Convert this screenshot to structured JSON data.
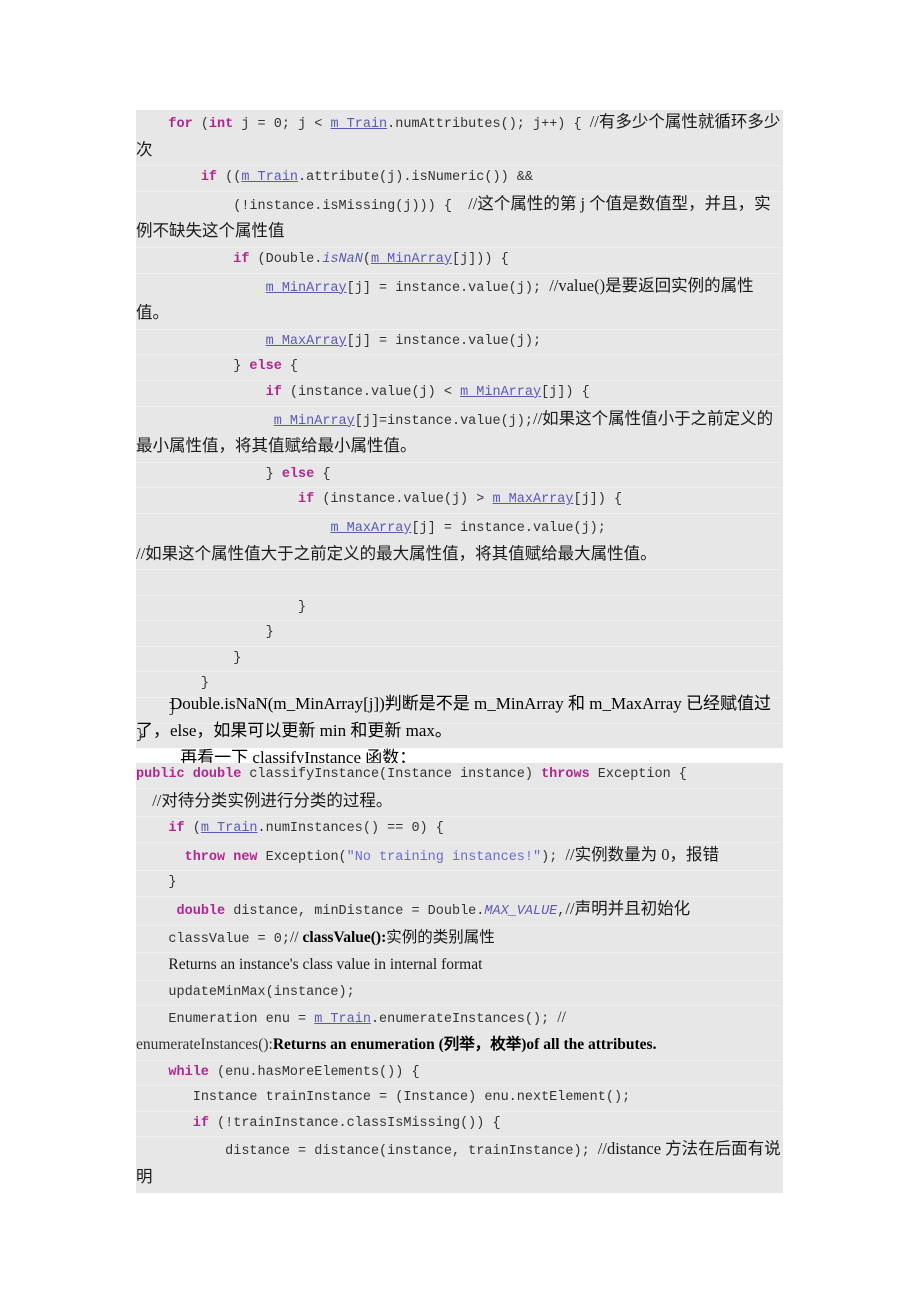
{
  "document": {
    "page_background": "#ffffff",
    "code_background": "#e7e7e7",
    "keyword_color": "#b0268f",
    "identifier_color": "#5a5ab4",
    "string_color": "#6b6bd6"
  },
  "code_block_1": {
    "name": "updateMinMax inner loop",
    "lines": [
      {
        "id": "l1",
        "segments": [
          {
            "t": "    ",
            "s": "plain"
          },
          {
            "t": "for",
            "s": "kw"
          },
          {
            "t": " (",
            "s": "plain"
          },
          {
            "t": "int",
            "s": "kw"
          },
          {
            "t": " j = 0; j < ",
            "s": "plain"
          },
          {
            "t": "m_Train",
            "s": "ident"
          },
          {
            "t": ".numAttributes(); j++) { ",
            "s": "plain"
          },
          {
            "t": "//有多少个属性就循环多少次",
            "s": "cmt-cn"
          }
        ]
      },
      {
        "id": "l2",
        "segments": [
          {
            "t": "        ",
            "s": "plain"
          },
          {
            "t": "if",
            "s": "kw"
          },
          {
            "t": " ((",
            "s": "plain"
          },
          {
            "t": "m_Train",
            "s": "ident"
          },
          {
            "t": ".attribute(j).isNumeric()) &&",
            "s": "plain"
          }
        ]
      },
      {
        "id": "l3",
        "segments": [
          {
            "t": "            (!instance.isMissing(j))) {  ",
            "s": "plain"
          },
          {
            "t": "//这个属性的第 j 个值是数值型，并且，实例不缺失这个属性值",
            "s": "cmt-cn"
          }
        ]
      },
      {
        "id": "l4",
        "segments": [
          {
            "t": "            ",
            "s": "plain"
          },
          {
            "t": "if",
            "s": "kw"
          },
          {
            "t": " (Double.",
            "s": "plain"
          },
          {
            "t": "isNaN",
            "s": "field"
          },
          {
            "t": "(",
            "s": "plain"
          },
          {
            "t": "m_MinArray",
            "s": "ident"
          },
          {
            "t": "[j])) {",
            "s": "plain"
          }
        ]
      },
      {
        "id": "l5",
        "segments": [
          {
            "t": "                ",
            "s": "plain"
          },
          {
            "t": "m_MinArray",
            "s": "ident"
          },
          {
            "t": "[j] = instance.value(j); ",
            "s": "plain"
          },
          {
            "t": "//value()是要返回实例的属性值。",
            "s": "cmt-cn"
          }
        ]
      },
      {
        "id": "l6",
        "segments": [
          {
            "t": "                ",
            "s": "plain"
          },
          {
            "t": "m_MaxArray",
            "s": "ident"
          },
          {
            "t": "[j] = instance.value(j);",
            "s": "plain"
          }
        ]
      },
      {
        "id": "l7",
        "segments": [
          {
            "t": "            } ",
            "s": "plain"
          },
          {
            "t": "else",
            "s": "kw"
          },
          {
            "t": " {",
            "s": "plain"
          }
        ]
      },
      {
        "id": "l8",
        "segments": [
          {
            "t": "                ",
            "s": "plain"
          },
          {
            "t": "if",
            "s": "kw"
          },
          {
            "t": " (instance.value(j) < ",
            "s": "plain"
          },
          {
            "t": "m_MinArray",
            "s": "ident"
          },
          {
            "t": "[j]) {",
            "s": "plain"
          }
        ]
      },
      {
        "id": "l9",
        "segments": [
          {
            "t": "                 ",
            "s": "plain"
          },
          {
            "t": "m_MinArray",
            "s": "ident"
          },
          {
            "t": "[j]=instance.value(j);",
            "s": "plain"
          },
          {
            "t": "//如果这个属性值小于之前定义的最小属性值，将其值赋给最小属性值。",
            "s": "cmt-cn"
          }
        ]
      },
      {
        "id": "l10",
        "segments": [
          {
            "t": "                } ",
            "s": "plain"
          },
          {
            "t": "else",
            "s": "kw"
          },
          {
            "t": " {",
            "s": "plain"
          }
        ]
      },
      {
        "id": "l11",
        "segments": [
          {
            "t": "                    ",
            "s": "plain"
          },
          {
            "t": "if",
            "s": "kw"
          },
          {
            "t": " (instance.value(j) > ",
            "s": "plain"
          },
          {
            "t": "m_MaxArray",
            "s": "ident"
          },
          {
            "t": "[j]) {",
            "s": "plain"
          }
        ]
      },
      {
        "id": "l12",
        "segments": [
          {
            "t": "                        ",
            "s": "plain"
          },
          {
            "t": "m_MaxArray",
            "s": "ident"
          },
          {
            "t": "[j] = instance.value(j);",
            "s": "plain"
          },
          {
            "t": "\n//如果这个属性值大于之前定义的最大属性值，将其值赋给最大属性值。",
            "s": "cmt-cn"
          }
        ]
      },
      {
        "id": "l13",
        "segments": [
          {
            "t": " ",
            "s": "plain"
          }
        ]
      },
      {
        "id": "l14",
        "segments": [
          {
            "t": "                    }",
            "s": "plain"
          }
        ]
      },
      {
        "id": "l15",
        "segments": [
          {
            "t": "                }",
            "s": "plain"
          }
        ]
      },
      {
        "id": "l16",
        "segments": [
          {
            "t": "            }",
            "s": "plain"
          }
        ]
      },
      {
        "id": "l17",
        "segments": [
          {
            "t": "        }",
            "s": "plain"
          }
        ]
      },
      {
        "id": "l18",
        "segments": [
          {
            "t": "    }",
            "s": "plain"
          }
        ]
      },
      {
        "id": "l19",
        "segments": [
          {
            "t": "}",
            "s": "plain"
          }
        ]
      }
    ]
  },
  "prose": {
    "isnan_paragraph": "Double.isNaN(m_MinArray[j])判断是不是 m_MinArray 和 m_MaxArray 已经赋值过了，else，如果可以更新 min 和更新 max。",
    "classify_lead": "再看一下 classifyInstance 函数："
  },
  "code_block_2": {
    "name": "classifyInstance",
    "lines": [
      {
        "id": "m1",
        "segments": [
          {
            "t": "public",
            "s": "kw"
          },
          {
            "t": " ",
            "s": "plain"
          },
          {
            "t": "double",
            "s": "kw"
          },
          {
            "t": " classifyInstance(Instance instance) ",
            "s": "plain"
          },
          {
            "t": "throws",
            "s": "kw"
          },
          {
            "t": " Exception {",
            "s": "plain"
          }
        ]
      },
      {
        "id": "m2",
        "segments": [
          {
            "t": "  ",
            "s": "plain"
          },
          {
            "t": "//对待分类实例进行分类的过程。",
            "s": "cmt-cn"
          }
        ]
      },
      {
        "id": "m3",
        "segments": [
          {
            "t": "    ",
            "s": "plain"
          },
          {
            "t": "if",
            "s": "kw"
          },
          {
            "t": " (",
            "s": "plain"
          },
          {
            "t": "m_Train",
            "s": "ident"
          },
          {
            "t": ".numInstances() == 0) {",
            "s": "plain"
          }
        ]
      },
      {
        "id": "m4",
        "segments": [
          {
            "t": "      ",
            "s": "plain"
          },
          {
            "t": "throw",
            "s": "kw"
          },
          {
            "t": " ",
            "s": "plain"
          },
          {
            "t": "new",
            "s": "kw"
          },
          {
            "t": " Exception(",
            "s": "plain"
          },
          {
            "t": "\"No training instances!\"",
            "s": "str"
          },
          {
            "t": "); ",
            "s": "plain"
          },
          {
            "t": "//实例数量为 0，报错",
            "s": "cmt-cn"
          }
        ]
      },
      {
        "id": "m5",
        "segments": [
          {
            "t": "    }",
            "s": "plain"
          }
        ]
      },
      {
        "id": "m6",
        "segments": [
          {
            "t": "     ",
            "s": "plain"
          },
          {
            "t": "double",
            "s": "kw"
          },
          {
            "t": " distance, minDistance = Double.",
            "s": "plain"
          },
          {
            "t": "MAX_VALUE",
            "s": "field"
          },
          {
            "t": ",",
            "s": "plain"
          },
          {
            "t": "//声明并且初始化",
            "s": "cmt-cn"
          }
        ]
      },
      {
        "id": "m7",
        "segments": [
          {
            "t": "    classValue = 0;",
            "s": "plain"
          },
          {
            "t": "// ",
            "s": "cmt-en"
          },
          {
            "t": "classValue():",
            "s": "cmt-b"
          },
          {
            "t": "实例的类别属性",
            "s": "cmt-en"
          }
        ]
      },
      {
        "id": "m8",
        "segments": [
          {
            "t": "    ",
            "s": "plain"
          },
          {
            "t": "Returns an instance's class value in internal format",
            "s": "cmt-en"
          }
        ]
      },
      {
        "id": "m9",
        "segments": [
          {
            "t": "    updateMinMax(instance);",
            "s": "plain"
          }
        ]
      },
      {
        "id": "m10",
        "segments": [
          {
            "t": "    Enumeration enu = ",
            "s": "plain"
          },
          {
            "t": "m_Train",
            "s": "ident"
          },
          {
            "t": ".enumerateInstances(); ",
            "s": "plain"
          },
          {
            "t": "//",
            "s": "cmt-en"
          },
          {
            "t": "\nenumerateInstances():",
            "s": "mono-plain"
          },
          {
            "t": "Returns an enumeration (列举，枚举)of all the attributes.",
            "s": "cmt-b"
          }
        ]
      },
      {
        "id": "m11",
        "segments": [
          {
            "t": "    ",
            "s": "plain"
          },
          {
            "t": "while",
            "s": "kw"
          },
          {
            "t": " (enu.hasMoreElements()) {",
            "s": "plain"
          }
        ]
      },
      {
        "id": "m12",
        "segments": [
          {
            "t": "       Instance trainInstance = (Instance) enu.nextElement();",
            "s": "plain"
          }
        ]
      },
      {
        "id": "m13",
        "segments": [
          {
            "t": "       ",
            "s": "plain"
          },
          {
            "t": "if",
            "s": "kw"
          },
          {
            "t": " (!trainInstance.classIsMissing()) {",
            "s": "plain"
          }
        ]
      },
      {
        "id": "m14",
        "segments": [
          {
            "t": "           distance = distance(instance, trainInstance); ",
            "s": "plain"
          },
          {
            "t": "//distance 方法在后面有说明",
            "s": "cmt-cn"
          }
        ]
      }
    ]
  }
}
